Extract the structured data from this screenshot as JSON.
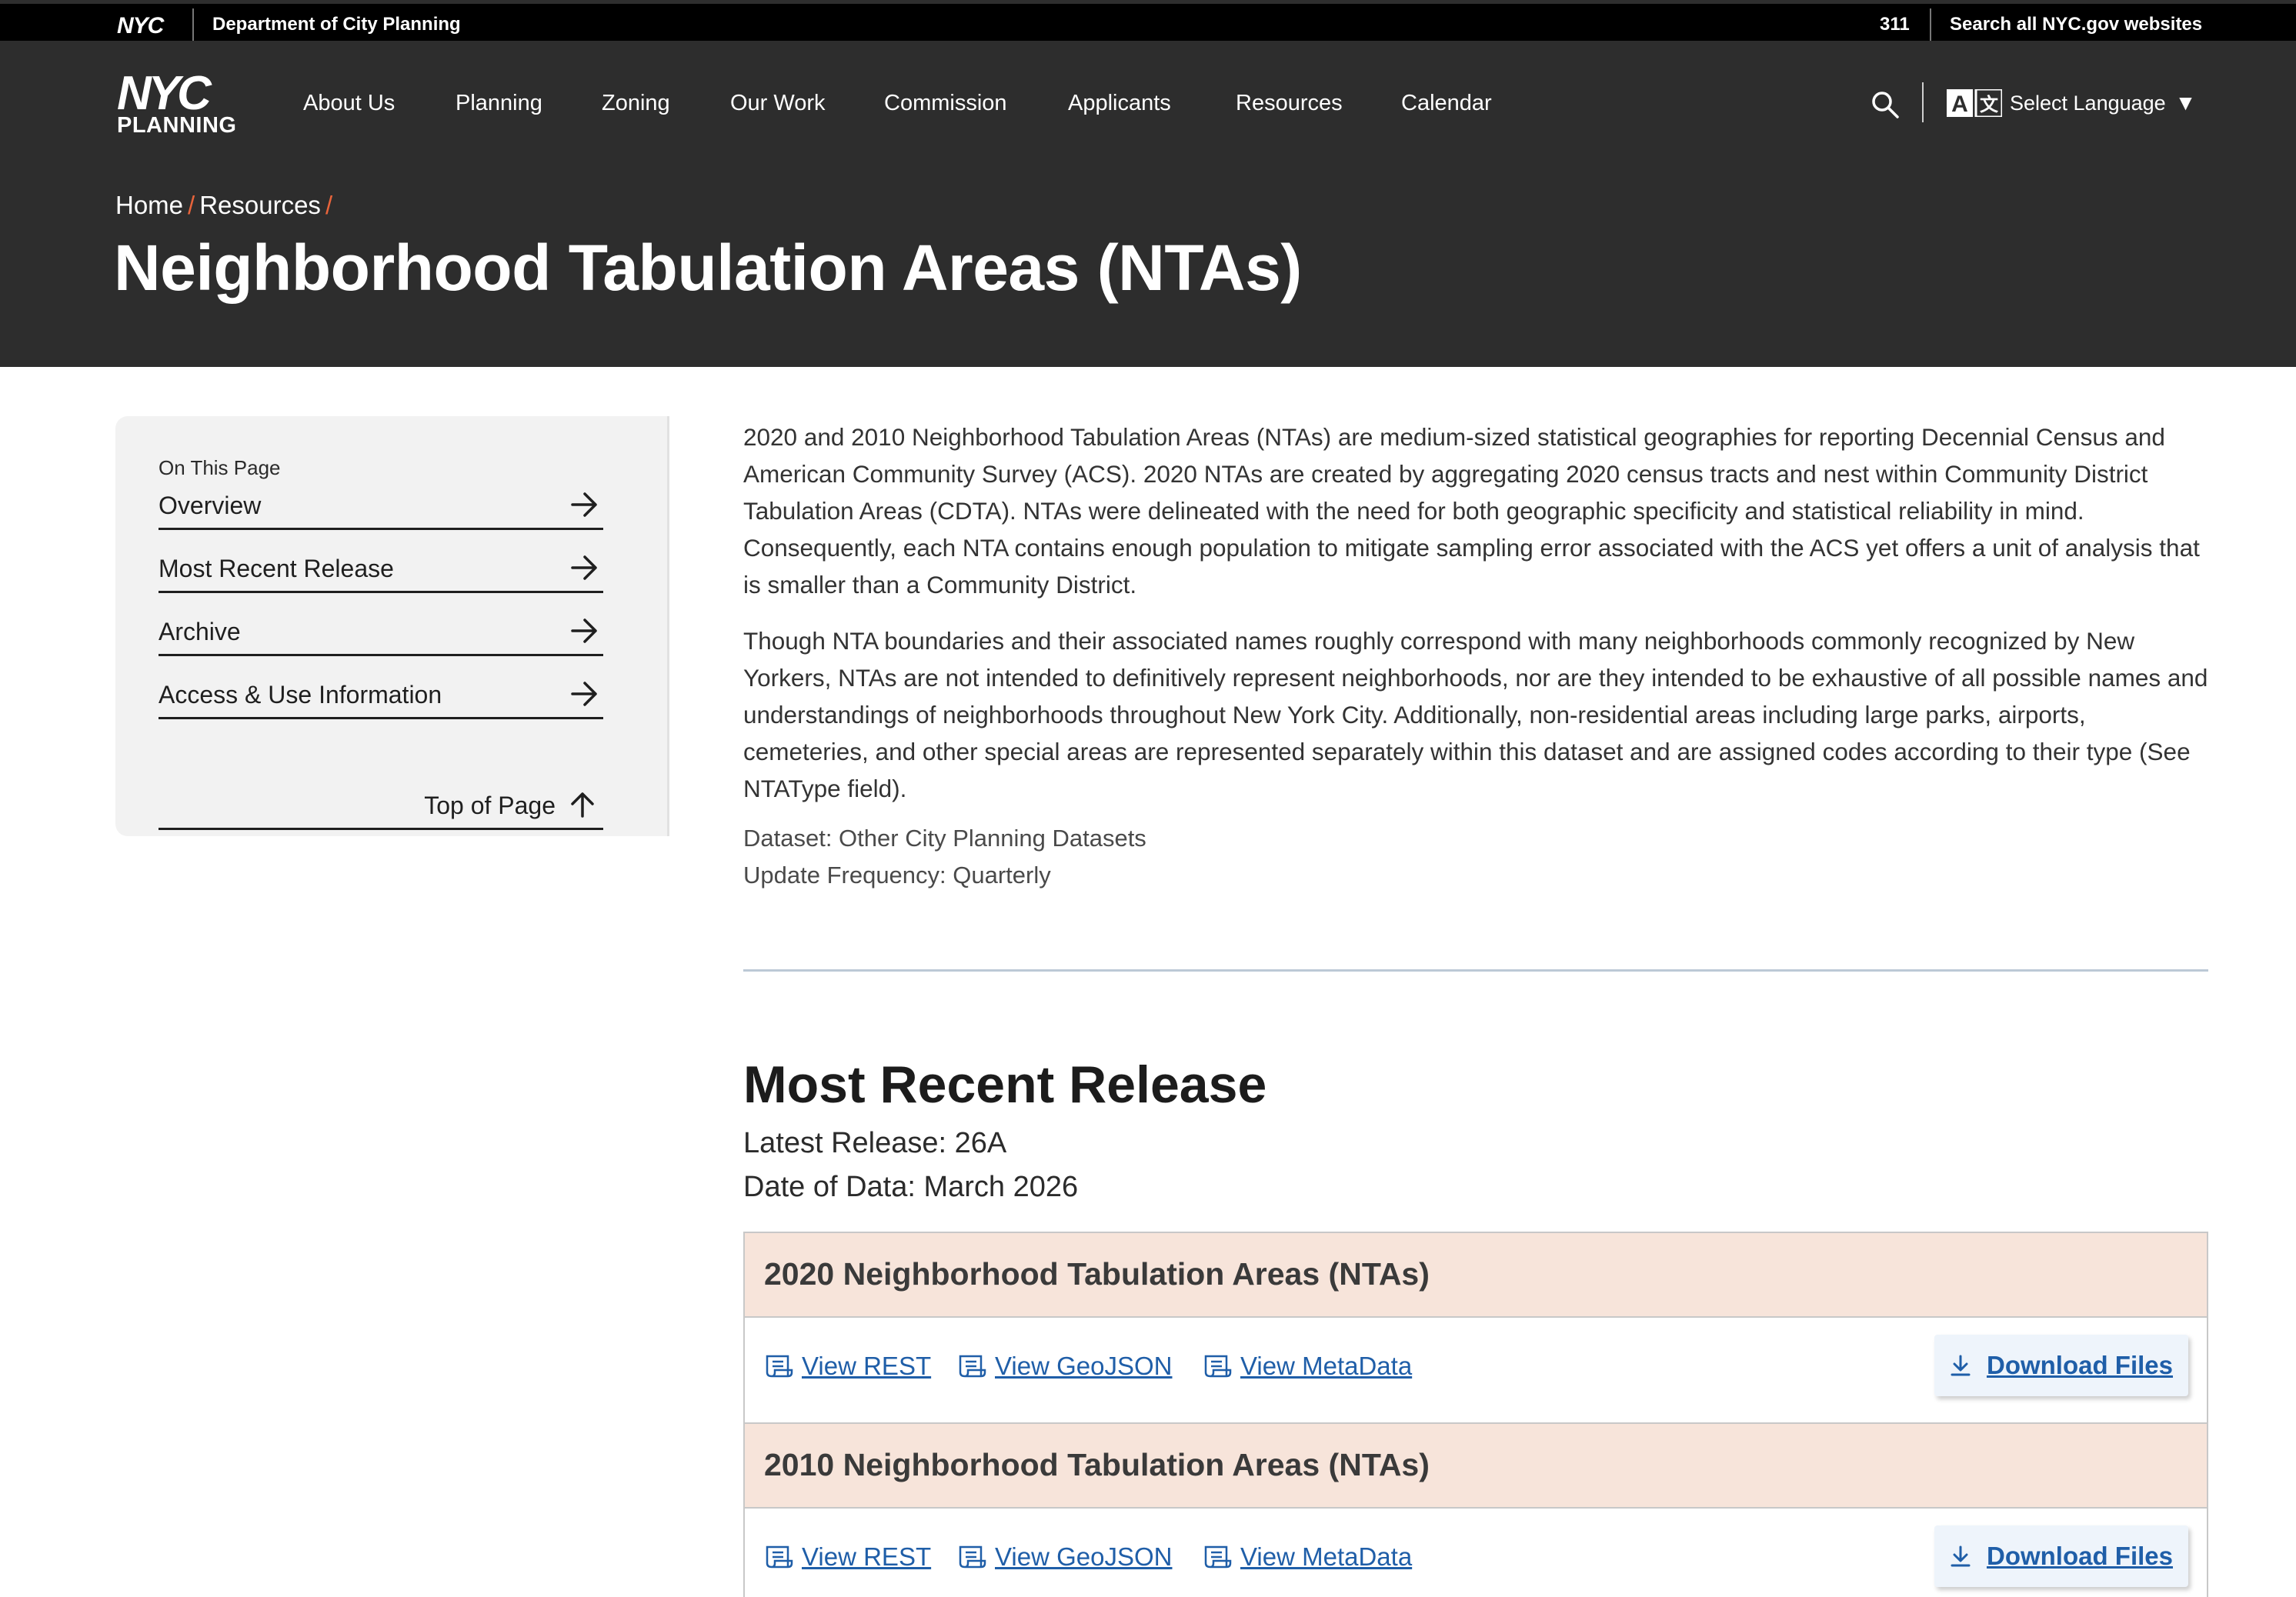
{
  "topbar": {
    "nyc_logo": "NYC",
    "department": "Department of City Planning",
    "link_311": "311",
    "search_all": "Search all NYC.gov websites"
  },
  "header": {
    "logo": {
      "line1": "NYC",
      "line2": "PLANNING"
    },
    "nav": [
      "About Us",
      "Planning",
      "Zoning",
      "Our Work",
      "Commission",
      "Applicants",
      "Resources",
      "Calendar"
    ],
    "search_icon": "search-icon",
    "language": {
      "label": "Select Language",
      "icon": "translate-icon"
    }
  },
  "breadcrumb": {
    "home": "Home",
    "resources": "Resources",
    "separator": "/"
  },
  "page_title": "Neighborhood Tabulation Areas (NTAs)",
  "sidebar": {
    "heading": "On This Page",
    "items": [
      {
        "label": "Overview"
      },
      {
        "label": "Most Recent Release"
      },
      {
        "label": "Archive"
      },
      {
        "label": "Access & Use Information"
      }
    ],
    "top_of_page": "Top of Page"
  },
  "overview": {
    "paragraph1": "2020 and 2010 Neighborhood Tabulation Areas (NTAs) are medium-sized statistical geographies for reporting Decennial Census and American Community Survey (ACS). 2020 NTAs are created by aggregating 2020 census tracts and nest within Community District Tabulation Areas (CDTA). NTAs were delineated with the need for both geographic specificity and statistical reliability in mind. Consequently, each NTA contains enough population to mitigate sampling error associated with the ACS yet offers a unit of analysis that is smaller than a Community District.",
    "paragraph2": "Though NTA boundaries and their associated names roughly correspond with many neighborhoods commonly recognized by New Yorkers, NTAs are not intended to definitively represent neighborhoods, nor are they intended to be exhaustive of all possible names and understandings of neighborhoods throughout New York City. Additionally, non-residential areas including large parks, airports, cemeteries, and other special areas are represented separately within this dataset and are assigned codes according to their type (See NTAType field).",
    "dataset": "Dataset: Other City Planning Datasets",
    "update_frequency": "Update Frequency: Quarterly"
  },
  "most_recent_release": {
    "title": "Most Recent Release",
    "latest_release": "Latest Release: 26A",
    "date_of_data": "Date of Data: March 2026",
    "datasets": [
      {
        "title": "2020 Neighborhood Tabulation Areas (NTAs)",
        "links": [
          "View REST",
          "View GeoJSON",
          "View MetaData"
        ],
        "download": "Download Files"
      },
      {
        "title": "2010 Neighborhood Tabulation Areas (NTAs)",
        "links": [
          "View REST",
          "View GeoJSON",
          "View MetaData"
        ],
        "download": "Download Files"
      }
    ]
  },
  "colors": {
    "header_bg": "#2d2d2d",
    "topbar_bg": "#000000",
    "breadcrumb_separator": "#e8643b",
    "dataset_header_bg": "#f7e4da",
    "link": "#1f5ea8",
    "download_bg": "#eef4fb"
  }
}
